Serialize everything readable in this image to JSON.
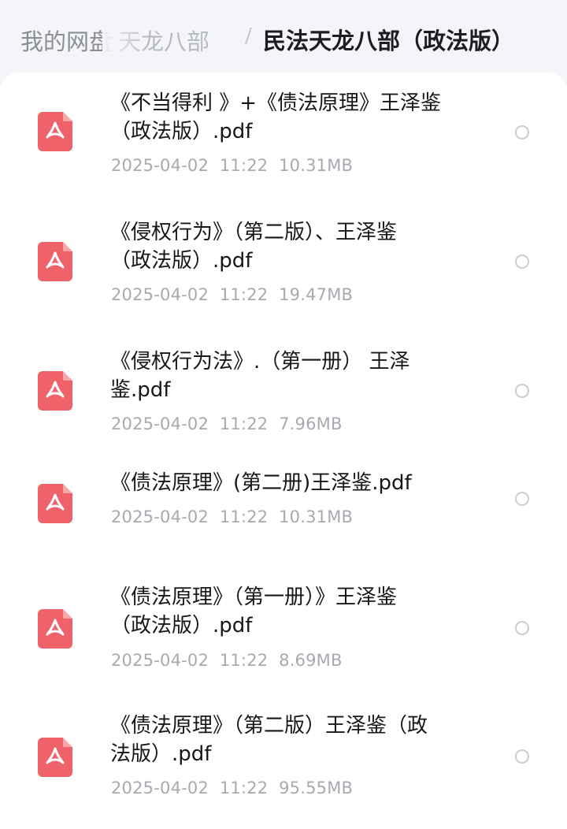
{
  "breadcrumb": {
    "root": "我的网盘",
    "middle": "天龙八部",
    "separator": "/",
    "current": "民法天龙八部（政法版）"
  },
  "files": [
    {
      "line1": "《不当得利 》+《债法原理》王泽鉴",
      "line2": "（政法版）.pdf",
      "date": "2025-04-02",
      "time": "11:22",
      "size": "10.31MB"
    },
    {
      "line1": "《侵权行为》（第二版）、王泽鉴",
      "line2": "（政法版）.pdf",
      "date": "2025-04-02",
      "time": "11:22",
      "size": "19.47MB"
    },
    {
      "line1": "《侵权行为法》.（第一册） 王泽",
      "line2": "鉴.pdf",
      "date": "2025-04-02",
      "time": "11:22",
      "size": "7.96MB"
    },
    {
      "line1": "《债法原理》(第二册)王泽鉴.pdf",
      "line2": "",
      "date": "2025-04-02",
      "time": "11:22",
      "size": "10.31MB"
    },
    {
      "line1": "《债法原理》（第一册）》王泽鉴",
      "line2": "（政法版）.pdf",
      "date": "2025-04-02",
      "time": "11:22",
      "size": "8.69MB"
    },
    {
      "line1": "《债法原理》（第二版）王泽鉴（政",
      "line2": "法版）.pdf",
      "date": "2025-04-02",
      "time": "11:22",
      "size": "95.55MB"
    }
  ],
  "icons": {
    "file_icon": "pdf-file-icon",
    "select_icon": "radio-circle-icon"
  },
  "colors": {
    "pdf_red": "#f0626a",
    "text_primary": "#16171b",
    "text_meta": "#a7aab0"
  }
}
